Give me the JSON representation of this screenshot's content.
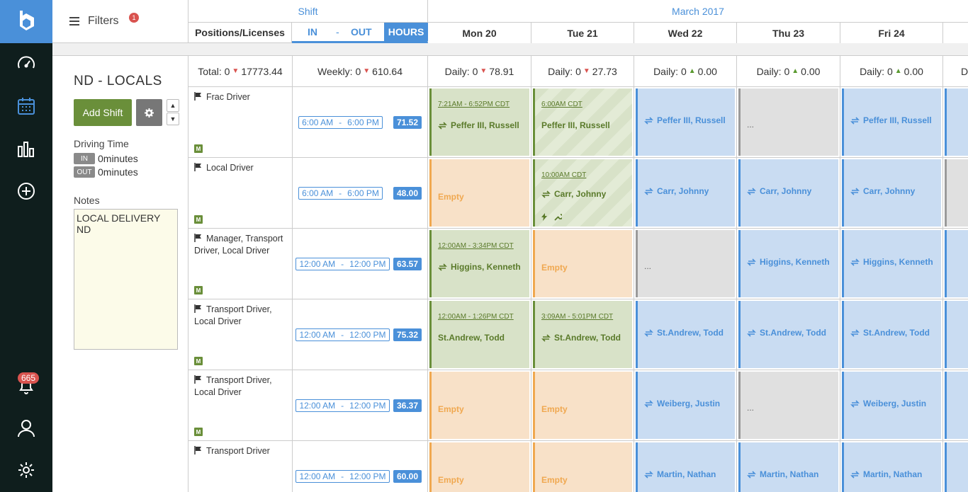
{
  "nav": {
    "notification_count": "665"
  },
  "filters": {
    "label": "Filters",
    "badge": "1"
  },
  "header": {
    "shift_label": "Shift",
    "month_label": "March 2017",
    "positions_label": "Positions/Licenses",
    "in_label": "IN",
    "dash": "-",
    "out_label": "OUT",
    "hours_label": "HOURS",
    "days": [
      "Mon 20",
      "Tue 21",
      "Wed 22",
      "Thu 23",
      "Fri 24"
    ]
  },
  "info": {
    "title": "ND - LOCALS",
    "add_shift": "Add Shift",
    "driving_time_label": "Driving Time",
    "in_tag": "IN",
    "out_tag": "OUT",
    "in_value": "0minutes",
    "out_value": "0minutes",
    "notes_label": "Notes",
    "notes_value": "LOCAL DELIVERY ND"
  },
  "totals": {
    "total": {
      "label": "Total:",
      "value": "0",
      "amount": "17773.44"
    },
    "weekly": {
      "label": "Weekly:",
      "value": "0",
      "amount": "610.64"
    },
    "daily": [
      {
        "label": "Daily:",
        "value": "0",
        "amount": "78.91",
        "trend": "down"
      },
      {
        "label": "Daily:",
        "value": "0",
        "amount": "27.73",
        "trend": "down"
      },
      {
        "label": "Daily:",
        "value": "0",
        "amount": "0.00",
        "trend": "up"
      },
      {
        "label": "Daily:",
        "value": "0",
        "amount": "0.00",
        "trend": "up"
      },
      {
        "label": "Daily:",
        "value": "0",
        "amount": "0.00",
        "trend": "up"
      }
    ],
    "partial_label": "D"
  },
  "rows": [
    {
      "position": "Frac Driver",
      "badge": "M",
      "start": "6:00 AM",
      "end": "6:00 PM",
      "hours": "71.52",
      "days": [
        {
          "type": "green",
          "time": "7:21AM - 6:52PM CDT",
          "name": "Peffer III, Russell"
        },
        {
          "type": "green-hatch",
          "time": "6:00AM CDT",
          "name": "Peffer III, Russell"
        },
        {
          "type": "blue",
          "name": "Peffer III, Russell"
        },
        {
          "type": "grey",
          "name": "..."
        },
        {
          "type": "blue",
          "name": "Peffer III, Russell"
        }
      ]
    },
    {
      "position": "Local Driver",
      "badge": "M",
      "start": "6:00 AM",
      "end": "6:00 PM",
      "hours": "48.00",
      "days": [
        {
          "type": "empty",
          "name": "Empty"
        },
        {
          "type": "green-hatch",
          "time": "10:00AM CDT",
          "name": "Carr, Johnny",
          "tools": true
        },
        {
          "type": "blue",
          "name": "Carr, Johnny"
        },
        {
          "type": "blue",
          "name": "Carr, Johnny"
        },
        {
          "type": "blue",
          "name": "Carr, Johnny"
        }
      ]
    },
    {
      "position": "Manager, Transport Driver, Local Driver",
      "badge": "M",
      "start": "12:00 AM",
      "end": "12:00 PM",
      "hours": "63.57",
      "days": [
        {
          "type": "green",
          "time": "12:00AM - 3:34PM CDT",
          "name": "Higgins, Kenneth"
        },
        {
          "type": "empty",
          "name": "Empty"
        },
        {
          "type": "grey",
          "name": "..."
        },
        {
          "type": "blue",
          "name": "Higgins, Kenneth"
        },
        {
          "type": "blue",
          "name": "Higgins, Kenneth"
        }
      ]
    },
    {
      "position": "Transport Driver, Local Driver",
      "badge": "M",
      "start": "12:00 AM",
      "end": "12:00 PM",
      "hours": "75.32",
      "days": [
        {
          "type": "green",
          "time": "12:00AM - 1:26PM CDT",
          "name": "St.Andrew, Todd",
          "noicon": true
        },
        {
          "type": "green",
          "time": "3:09AM - 5:01PM CDT",
          "name": "St.Andrew, Todd"
        },
        {
          "type": "blue",
          "name": "St.Andrew, Todd"
        },
        {
          "type": "blue",
          "name": "St.Andrew, Todd"
        },
        {
          "type": "blue",
          "name": "St.Andrew, Todd"
        }
      ]
    },
    {
      "position": "Transport Driver, Local Driver",
      "badge": "M",
      "start": "12:00 AM",
      "end": "12:00 PM",
      "hours": "36.37",
      "days": [
        {
          "type": "empty",
          "name": "Empty"
        },
        {
          "type": "empty",
          "name": "Empty"
        },
        {
          "type": "blue",
          "name": "Weiberg, Justin"
        },
        {
          "type": "grey",
          "name": "..."
        },
        {
          "type": "blue",
          "name": "Weiberg, Justin"
        }
      ]
    },
    {
      "position": "Transport Driver",
      "badge": "",
      "start": "12:00 AM",
      "end": "12:00 PM",
      "hours": "60.00",
      "days": [
        {
          "type": "empty",
          "name": "Empty"
        },
        {
          "type": "empty",
          "name": "Empty"
        },
        {
          "type": "blue",
          "name": "Martin, Nathan"
        },
        {
          "type": "blue",
          "name": "Martin, Nathan"
        },
        {
          "type": "blue",
          "name": "Martin, Nathan"
        }
      ]
    }
  ],
  "colors": {
    "accent": "#4a90d9",
    "rail": "#0f1e1d",
    "green": "#6a8f3a",
    "empty": "#f0a850"
  }
}
